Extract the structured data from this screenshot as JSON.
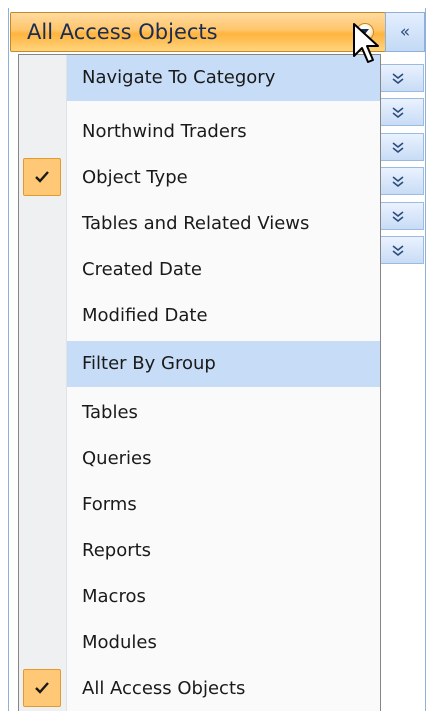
{
  "header": {
    "title": "All Access Objects",
    "collapse_glyph": "«"
  },
  "menu": {
    "items": [
      {
        "label": "Navigate To Category",
        "type": "category",
        "checked": false
      },
      {
        "label": "Northwind Traders",
        "type": "item",
        "checked": false
      },
      {
        "label": "Object Type",
        "type": "item",
        "checked": true
      },
      {
        "label": "Tables and Related Views",
        "type": "item",
        "checked": false
      },
      {
        "label": "Created Date",
        "type": "item",
        "checked": false
      },
      {
        "label": "Modified Date",
        "type": "item",
        "checked": false
      },
      {
        "label": "Filter By Group",
        "type": "category",
        "checked": false
      },
      {
        "label": "Tables",
        "type": "item",
        "checked": false
      },
      {
        "label": "Queries",
        "type": "item",
        "checked": false
      },
      {
        "label": "Forms",
        "type": "item",
        "checked": false
      },
      {
        "label": "Reports",
        "type": "item",
        "checked": false
      },
      {
        "label": "Macros",
        "type": "item",
        "checked": false
      },
      {
        "label": "Modules",
        "type": "item",
        "checked": false
      },
      {
        "label": "All Access Objects",
        "type": "item",
        "checked": true
      }
    ]
  },
  "colors": {
    "header_accent": "#ffc56a",
    "category_highlight": "#c6dcf7",
    "check_background": "#ffc876",
    "border_blue": "#8fb1d9"
  },
  "icons": {
    "dropdown": "chevron-down-icon",
    "collapse": "double-chevron-left-icon",
    "group": "double-chevron-down-icon",
    "check": "checkmark-icon",
    "cursor": "mouse-pointer-icon"
  }
}
